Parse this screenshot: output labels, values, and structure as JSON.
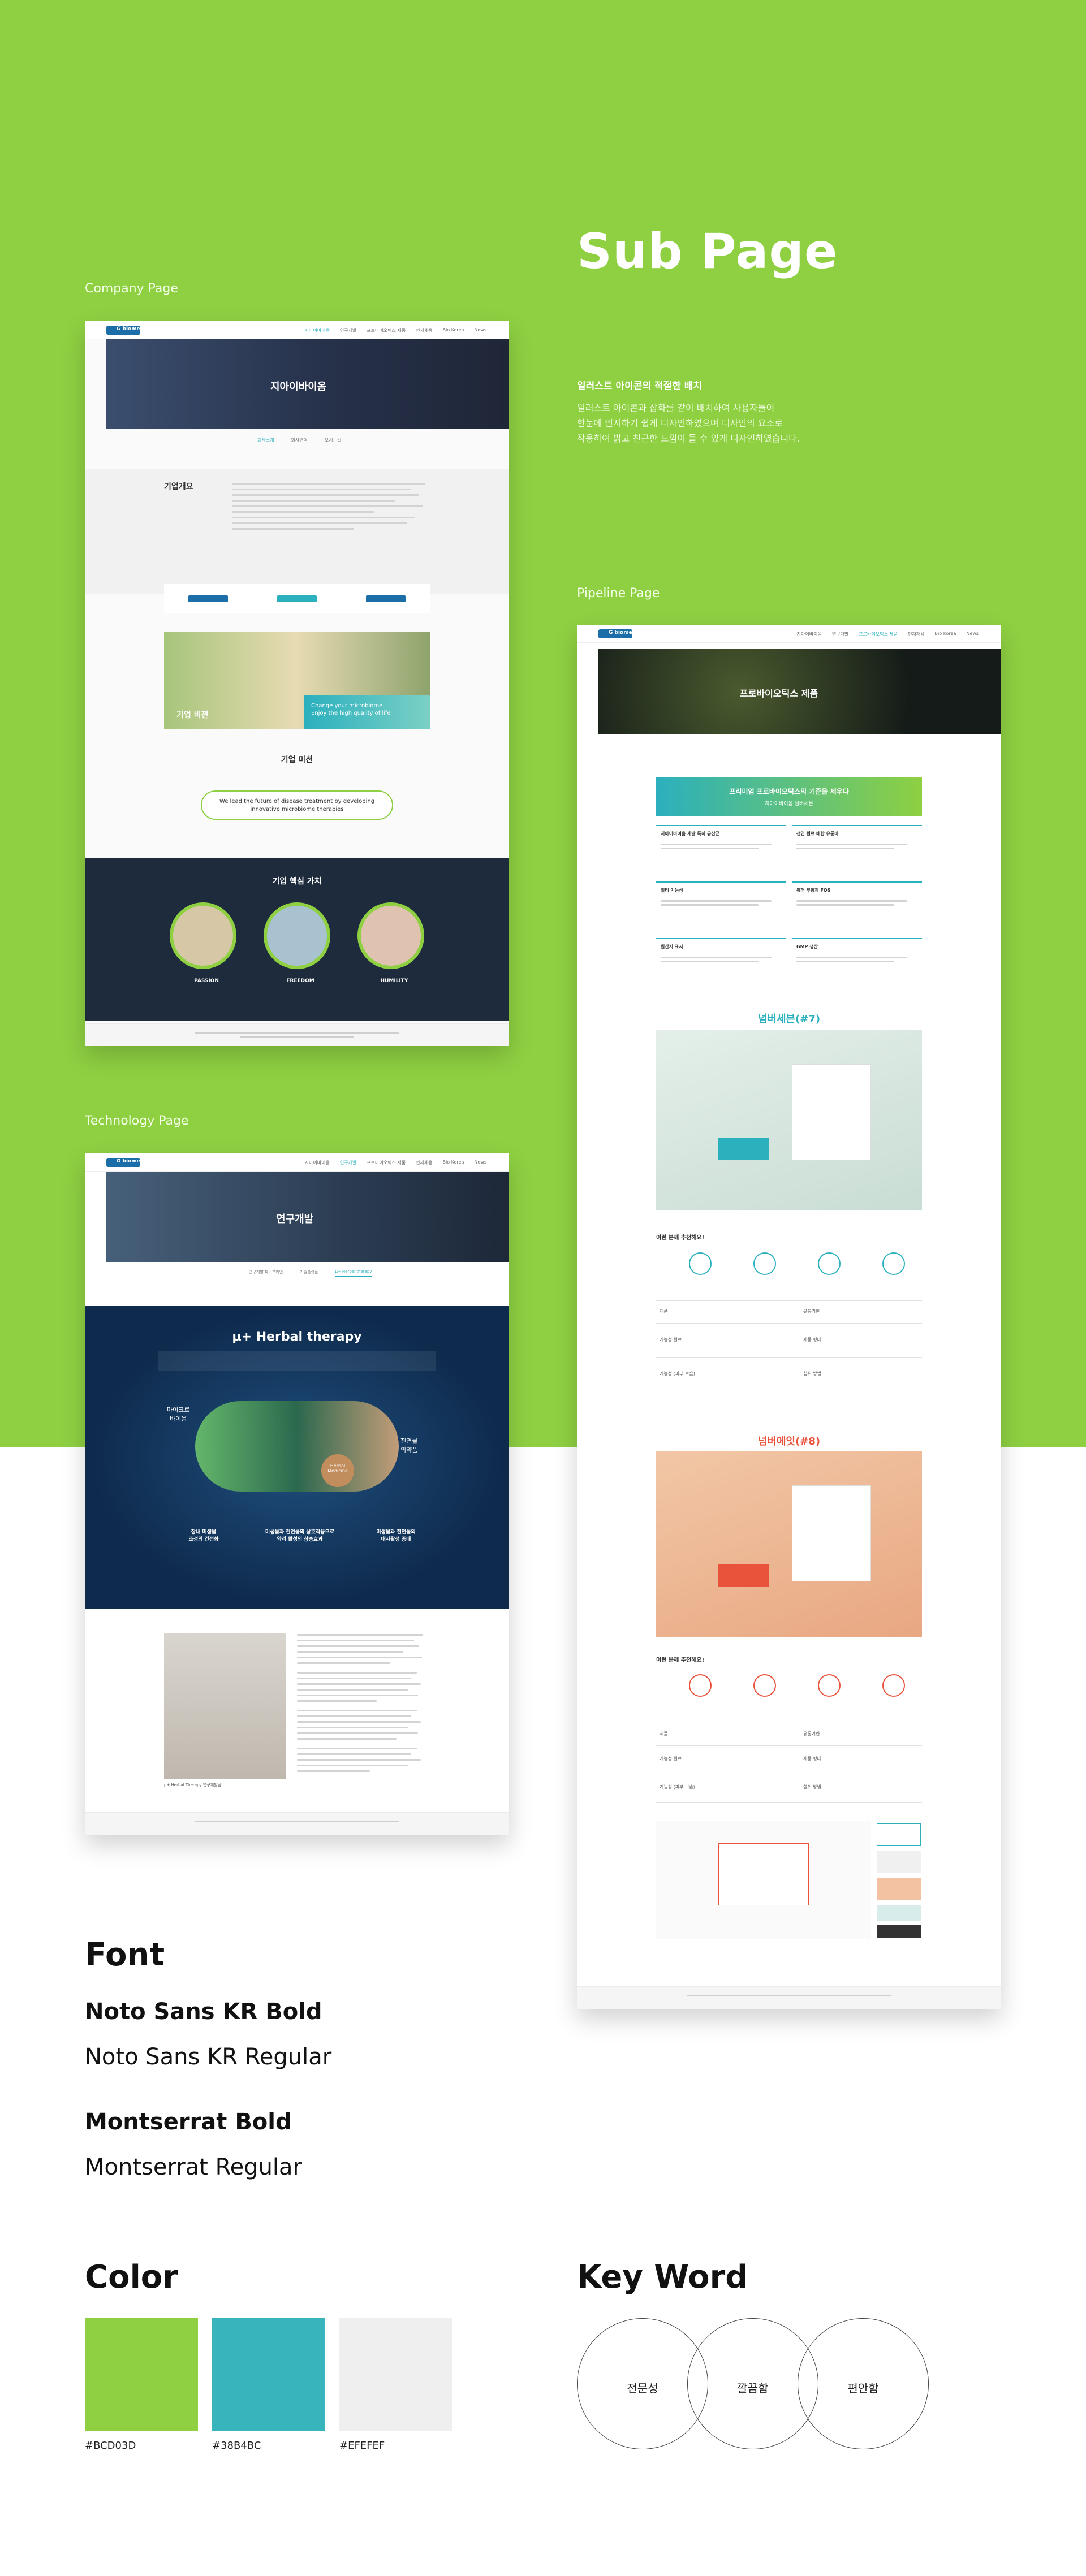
{
  "page": {
    "title": "Sub Page",
    "description_title": "일러스트 아이콘의 적절한 배치",
    "description_lines": [
      "일러스트 아이콘과 삽화를 같이 배치하여 사용자들이",
      "한눈에 인지하기 쉽게 디자인하였으며 디자인의 요소로",
      "작용하여 밝고 친근한 느낌이 들 수 있게 디자인하였습니다."
    ]
  },
  "sections": {
    "company_label": "Company Page",
    "technology_label": "Technology Page",
    "pipeline_label": "Pipeline Page"
  },
  "company_mock": {
    "logo": "G biome",
    "nav": [
      "지아이바이옴",
      "연구개발",
      "프로바이오틱스 제품",
      "인재채용",
      "Bio Korea",
      "News"
    ],
    "hero_title": "지아이바이옴",
    "tabs": [
      "회사소개",
      "회사연혁",
      "오시는길"
    ],
    "overview_title": "기업개요",
    "banner_title": "기업 비전",
    "banner_text": "Change your microbiome.\nEnjoy the high quality of life",
    "mission_title": "기업 미션",
    "mission_text": "We lead the future of disease treatment by developing innovative microbiome therapies",
    "values_title": "기업 핵심 가치",
    "values": [
      "PASSION",
      "FREEDOM",
      "HUMILITY"
    ]
  },
  "tech_mock": {
    "hero_title": "연구개발",
    "tabs": [
      "연구개발 파이프라인",
      "기술플랫폼",
      "μ+ Herbal therapy"
    ],
    "therapy_title": "μ+ Herbal therapy",
    "left_badge": "마이크로\n바이옴",
    "right_badge": "천연물\n의약품",
    "center_badge": "Herbal\nMedicine",
    "points": [
      "장내 미생물\n조성의 건전화",
      "미생물과 천연물의 상호작용으로\n약리 활성의 상승효과",
      "미생물과 천연물의\n대사활성 증대"
    ],
    "caption": "μ+ Herbal Therapy 연구개발팀"
  },
  "pipeline_mock": {
    "hero_title": "프로바이오틱스 제품",
    "promo": "프리미엄 프로바이오틱스의 기준을 세우다",
    "promo_sub": "지아이바이옴 넘버세븐",
    "features": [
      "지아이바이옴 개발 특허 유산균",
      "천연 원료 배합 유통바",
      "멀티 기능성",
      "특허 부형제 FOS",
      "원산지 표시",
      "GMP 생산"
    ],
    "product1": "넘버세븐(#7)",
    "product2": "넘버에잇(#8)",
    "recommend": "이런 분께 추천해요!",
    "spec_keys": [
      "제품",
      "기능성 원료",
      "기능성 (피부 보습)",
      "유통기한",
      "제품 형태",
      "섭취 방법"
    ]
  },
  "fonts": {
    "heading": "Font",
    "items": [
      "Noto Sans KR Bold",
      "Noto Sans KR Regular",
      "Montserrat Bold",
      "Montserrat Regular"
    ]
  },
  "colors": {
    "heading": "Color",
    "swatches": [
      {
        "hex": "#8CD03D",
        "label": "#BCD03D"
      },
      {
        "hex": "#38B4BC",
        "label": "#38B4BC"
      },
      {
        "hex": "#EFEFEF",
        "label": "#EFEFEF"
      }
    ]
  },
  "keywords": {
    "heading": "Key Word",
    "items": [
      "전문성",
      "깔끔함",
      "편안함"
    ]
  }
}
